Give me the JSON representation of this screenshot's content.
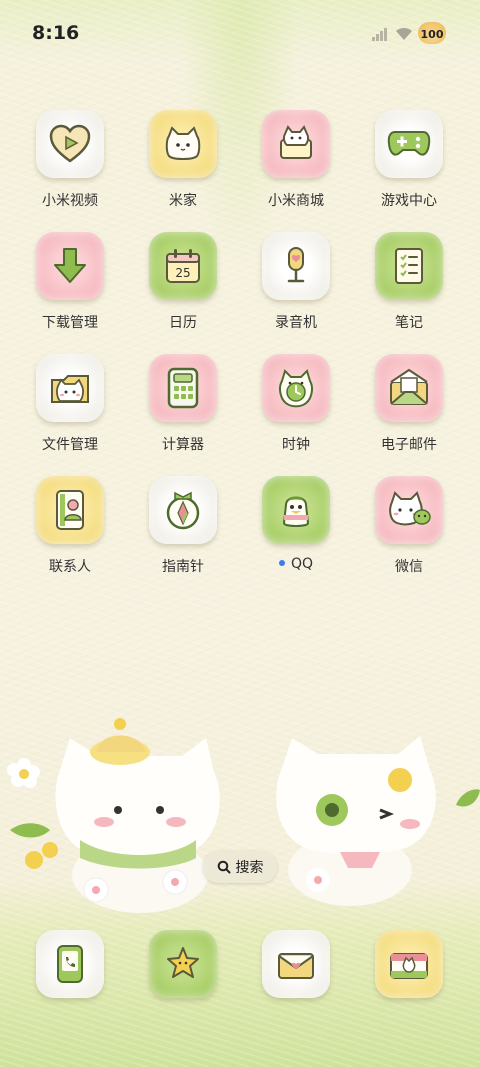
{
  "status": {
    "time": "8:16",
    "battery": "100"
  },
  "apps": [
    {
      "label": "小米视频",
      "icon": "video-heart-icon",
      "bg": "white"
    },
    {
      "label": "米家",
      "icon": "mijia-cat-icon",
      "bg": "yellow"
    },
    {
      "label": "小米商城",
      "icon": "mall-cat-icon",
      "bg": "pink"
    },
    {
      "label": "游戏中心",
      "icon": "gamepad-icon",
      "bg": "white"
    },
    {
      "label": "下载管理",
      "icon": "download-arrow-icon",
      "bg": "pink"
    },
    {
      "label": "日历",
      "icon": "calendar-icon",
      "bg": "green",
      "day": "25"
    },
    {
      "label": "录音机",
      "icon": "microphone-icon",
      "bg": "white"
    },
    {
      "label": "笔记",
      "icon": "notes-icon",
      "bg": "green"
    },
    {
      "label": "文件管理",
      "icon": "folder-cat-icon",
      "bg": "white"
    },
    {
      "label": "计算器",
      "icon": "calculator-icon",
      "bg": "pink"
    },
    {
      "label": "时钟",
      "icon": "clock-icon",
      "bg": "pink"
    },
    {
      "label": "电子邮件",
      "icon": "mail-icon",
      "bg": "pink"
    },
    {
      "label": "联系人",
      "icon": "contacts-icon",
      "bg": "yellow"
    },
    {
      "label": "指南针",
      "icon": "compass-icon",
      "bg": "white"
    },
    {
      "label": "QQ",
      "icon": "qq-penguin-icon",
      "bg": "green",
      "dot": true
    },
    {
      "label": "微信",
      "icon": "wechat-cat-icon",
      "bg": "pink"
    }
  ],
  "search": {
    "label": "搜索"
  },
  "dock": [
    {
      "icon": "phone-icon",
      "bg": "white"
    },
    {
      "icon": "star-message-icon",
      "bg": "green"
    },
    {
      "icon": "envelope-icon",
      "bg": "white"
    },
    {
      "icon": "camera-icon",
      "bg": "yellow"
    }
  ]
}
